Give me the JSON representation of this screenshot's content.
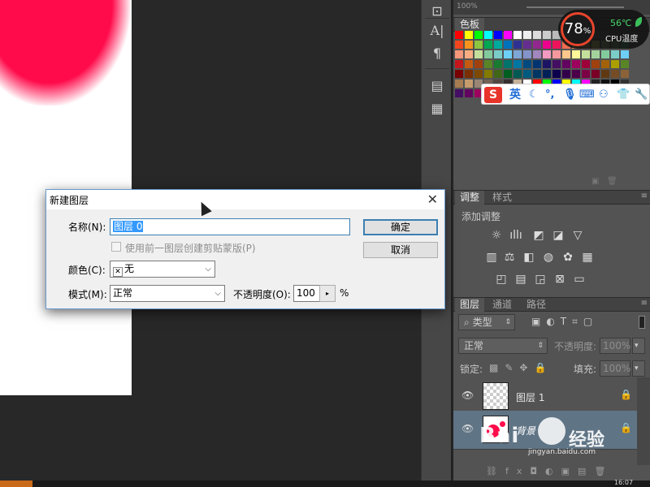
{
  "cpu_widget": {
    "usage_value": "78",
    "usage_unit": "%",
    "temperature": "56℃",
    "label": "CPU温度"
  },
  "ime_toolbar": {
    "logo": "S",
    "mode": "英",
    "icons": [
      "moon-icon",
      "punctuation-icon",
      "microphone-icon",
      "keyboard-icon",
      "user-icon",
      "shirt-icon",
      "wrench-icon"
    ]
  },
  "canvas": {
    "zoom_text": "100%"
  },
  "swatches_panel": {
    "tab": "色板"
  },
  "adjustments_panel": {
    "tabs": [
      "调整",
      "样式"
    ],
    "subtitle": "添加调整"
  },
  "layers_panel": {
    "tabs": [
      "图层",
      "通道",
      "路径"
    ],
    "filter_label": "类型",
    "blend_mode": "正常",
    "opacity_label": "不透明度:",
    "opacity_value": "100%",
    "lock_label": "锁定:",
    "fill_label": "填充:",
    "fill_value": "100%",
    "layers": [
      {
        "name": "图层 1"
      },
      {
        "name": "背景"
      }
    ],
    "footer_fx": "fx"
  },
  "dialog": {
    "title": "新建图层",
    "name_label": "名称(N):",
    "name_value": "图层 0",
    "clip_label": "使用前一图层创建剪贴蒙版(P)",
    "color_label": "颜色(C):",
    "color_value": "无",
    "mode_label": "模式(M):",
    "mode_value": "正常",
    "opacity_label": "不透明度(O):",
    "opacity_value": "100",
    "opacity_unit": "%",
    "ok_button": "确定",
    "cancel_button": "取消"
  },
  "watermark": {
    "text_left": "Bai",
    "text_right": "经验",
    "url": "jingyan.baidu.com"
  },
  "taskbar": {
    "clock": "16:07"
  }
}
